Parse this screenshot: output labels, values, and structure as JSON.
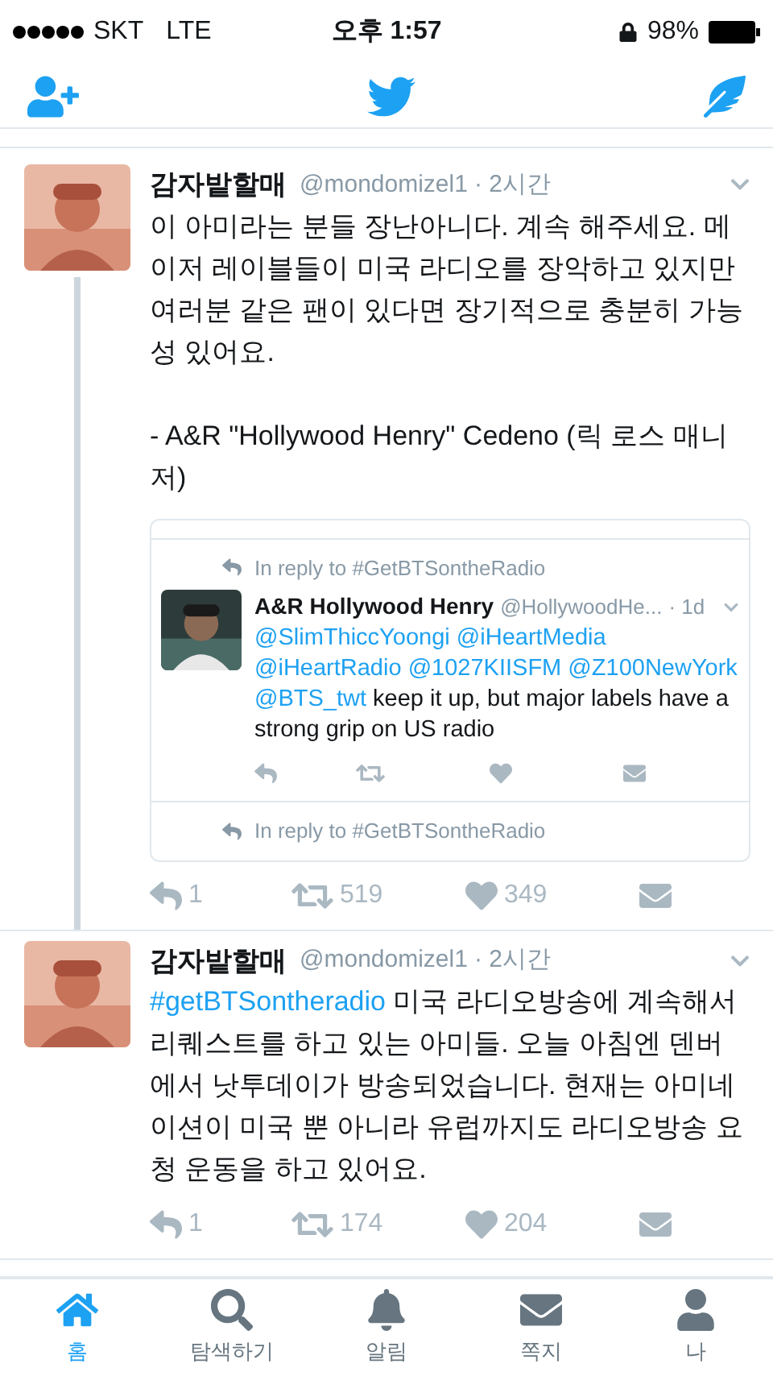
{
  "status_bar": {
    "carrier": "SKT",
    "network": "LTE",
    "time": "오후 1:57",
    "battery": "98%"
  },
  "tweets": [
    {
      "name": "감자밭할매",
      "handle": "@mondomizel1",
      "time": "· 2시간",
      "thread": true,
      "body": [
        [
          {
            "kind": "text",
            "text": "이 아미라는 분들 장난아니다. 계속 해주세요. 메이저 레이블들이 미국 라디오를 장악하고 있지만 여러분 같은 팬이 있다면 장기적으로 충분히 가능성 있어요."
          }
        ],
        [
          {
            "kind": "text",
            "text": "- A&R \"Hollywood Henry\" Cedeno (릭 로스 매니저)"
          }
        ]
      ],
      "quote": [
        {
          "kind": "tweet",
          "reply_to": "In reply to #GetBTSontheRadio",
          "name": "A&R Hollywood Henry",
          "handle": "@HollywoodHe...",
          "time": "· 1d",
          "body": [
            {
              "kind": "link",
              "text": "@SlimThiccYoongi"
            },
            {
              "kind": "link",
              "text": "@iHeartMedia"
            },
            {
              "kind": "link",
              "text": "@iHeartRadio"
            },
            {
              "kind": "link",
              "text": "@1027KIISFM"
            },
            {
              "kind": "link",
              "text": "@Z100NewYork"
            },
            {
              "kind": "link",
              "text": "@BTS_twt"
            },
            {
              "kind": "text",
              "text": "keep it up, but major labels have a strong grip on US radio"
            }
          ]
        },
        {
          "kind": "partial",
          "reply_to": "In reply to #GetBTSontheRadio"
        }
      ],
      "actions": {
        "reply": "1",
        "retweet": "519",
        "like": "349"
      }
    },
    {
      "name": "감자밭할매",
      "handle": "@mondomizel1",
      "time": "· 2시간",
      "thread": false,
      "body": [
        [
          {
            "kind": "link",
            "text": "#getBTSontheradio"
          },
          {
            "kind": "text",
            "text": "미국 라디오방송에 계속해서 리퀘스트를 하고 있는 아미들. 오늘 아침엔 덴버에서 낫투데이가 방송되었습니다. 현재는 아미네이션이 미국 뿐 아니라 유럽까지도 라디오방송 요청 운동을 하고 있어요."
          }
        ]
      ],
      "actions": {
        "reply": "1",
        "retweet": "174",
        "like": "204"
      }
    }
  ],
  "tab_bar": [
    {
      "label": "홈",
      "selected": true
    },
    {
      "label": "탐색하기",
      "selected": false
    },
    {
      "label": "알림",
      "selected": false
    },
    {
      "label": "쪽지",
      "selected": false
    },
    {
      "label": "나",
      "selected": false
    }
  ]
}
